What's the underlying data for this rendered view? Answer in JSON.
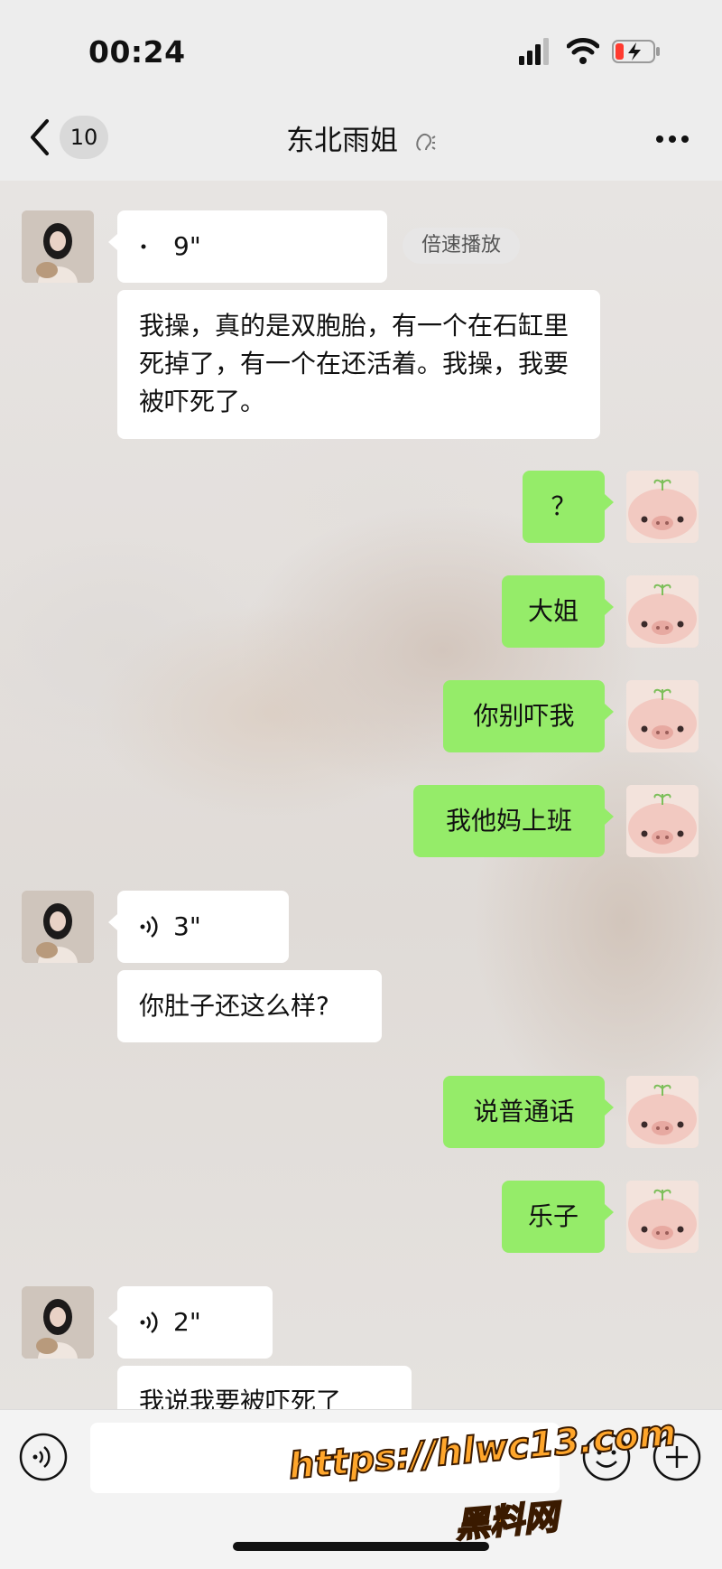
{
  "status_bar": {
    "time": "00:24"
  },
  "header": {
    "unread_count": "10",
    "title": "东北雨姐"
  },
  "messages": [
    {
      "side": "in",
      "type": "voice",
      "duration": "9\"",
      "speed_label": "倍速播放"
    },
    {
      "side": "in",
      "type": "text",
      "text": "我操，真的是双胞胎，有一个在石缸里死掉了，有一个在还活着。我操，我要被吓死了。"
    },
    {
      "side": "out",
      "type": "text",
      "text": "？"
    },
    {
      "side": "out",
      "type": "text",
      "text": "大姐"
    },
    {
      "side": "out",
      "type": "text",
      "text": "你别吓我"
    },
    {
      "side": "out",
      "type": "text",
      "text": "我他妈上班"
    },
    {
      "side": "in",
      "type": "voice",
      "duration": "3\""
    },
    {
      "side": "in",
      "type": "text",
      "text": "你肚子还这么样?"
    },
    {
      "side": "out",
      "type": "text",
      "text": "说普通话"
    },
    {
      "side": "out",
      "type": "text",
      "text": "乐子"
    },
    {
      "side": "in",
      "type": "voice",
      "duration": "2\""
    },
    {
      "side": "in",
      "type": "text",
      "text": "我说我要被吓死了"
    }
  ],
  "watermark": {
    "url": "https://hlwc13.com",
    "name": "黑料网"
  },
  "colors": {
    "incoming_bubble": "#ffffff",
    "outgoing_bubble": "#95ec69",
    "background": "#ededed"
  },
  "icons": [
    "back-icon",
    "signal-icon",
    "wifi-icon",
    "battery-icon",
    "ear-icon",
    "more-icon",
    "voice-icon",
    "emoji-icon",
    "plus-icon"
  ]
}
